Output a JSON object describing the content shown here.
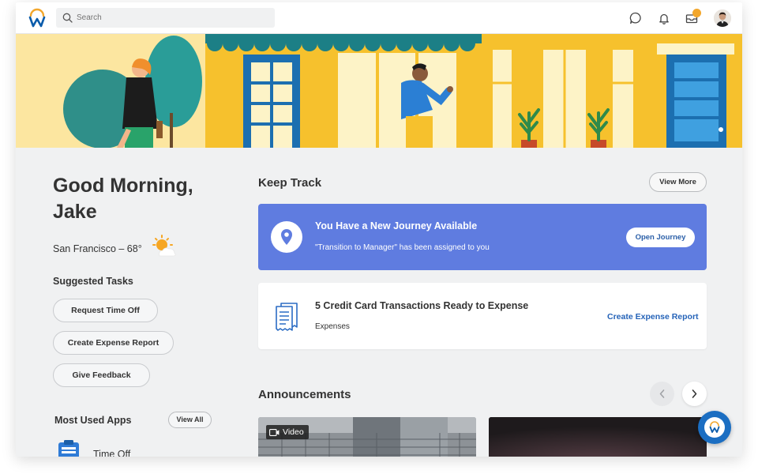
{
  "topbar": {
    "search_placeholder": "Search",
    "notification_badge": "",
    "icons": [
      "workday-logo-icon",
      "search-icon",
      "chat-icon",
      "bell-icon",
      "inbox-icon",
      "user-avatar"
    ]
  },
  "greeting": {
    "line1": "Good Morning,",
    "line2": "Jake",
    "weather": "San Francisco – 68°"
  },
  "suggested_tasks": {
    "heading": "Suggested Tasks",
    "items": [
      "Request Time Off",
      "Create Expense Report",
      "Give Feedback"
    ]
  },
  "most_used_apps": {
    "heading": "Most Used Apps",
    "view_all": "View All",
    "items": [
      "Time Off"
    ]
  },
  "keep_track": {
    "heading": "Keep Track",
    "view_more": "View More",
    "journey": {
      "title": "You Have a New Journey Available",
      "subtitle": "\"Transition to Manager\" has been assigned to you",
      "button": "Open Journey"
    },
    "expense": {
      "title": "5 Credit Card Transactions Ready to Expense",
      "subtitle": "Expenses",
      "link": "Create Expense Report"
    }
  },
  "announcements": {
    "heading": "Announcements",
    "video_tag": "Video"
  },
  "colors": {
    "journey_bg": "#5f7ce0",
    "link_blue": "#2563b8",
    "badge_orange": "#f3a72c",
    "fab_blue": "#1b6ec2"
  }
}
